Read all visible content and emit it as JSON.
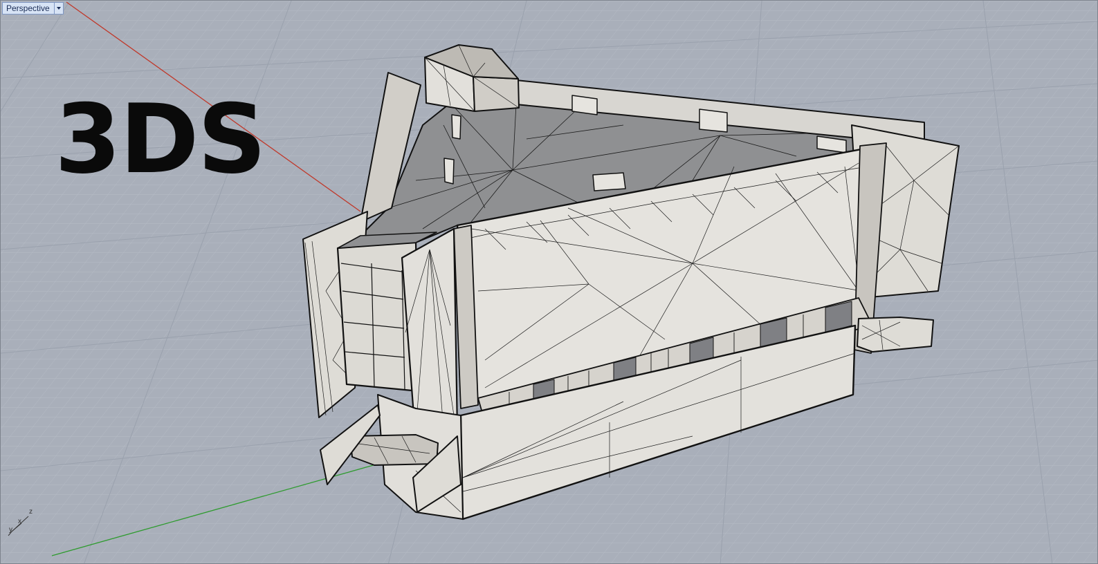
{
  "viewport": {
    "name": "Perspective",
    "grid_color": "#b8bec8",
    "grid_major_color": "#9ea5b0",
    "background": "#a7adb8",
    "x_axis_color": "#c0392b",
    "y_axis_color": "#2e9b2e"
  },
  "overlay": {
    "format_text": "3DS"
  },
  "axes_widget": {
    "x": "x",
    "y": "y",
    "z": "z"
  },
  "model": {
    "fill_light": "#e6e4df",
    "fill_mid": "#cfccc6",
    "fill_dark": "#8f8f8f",
    "edge_color": "#111111"
  }
}
